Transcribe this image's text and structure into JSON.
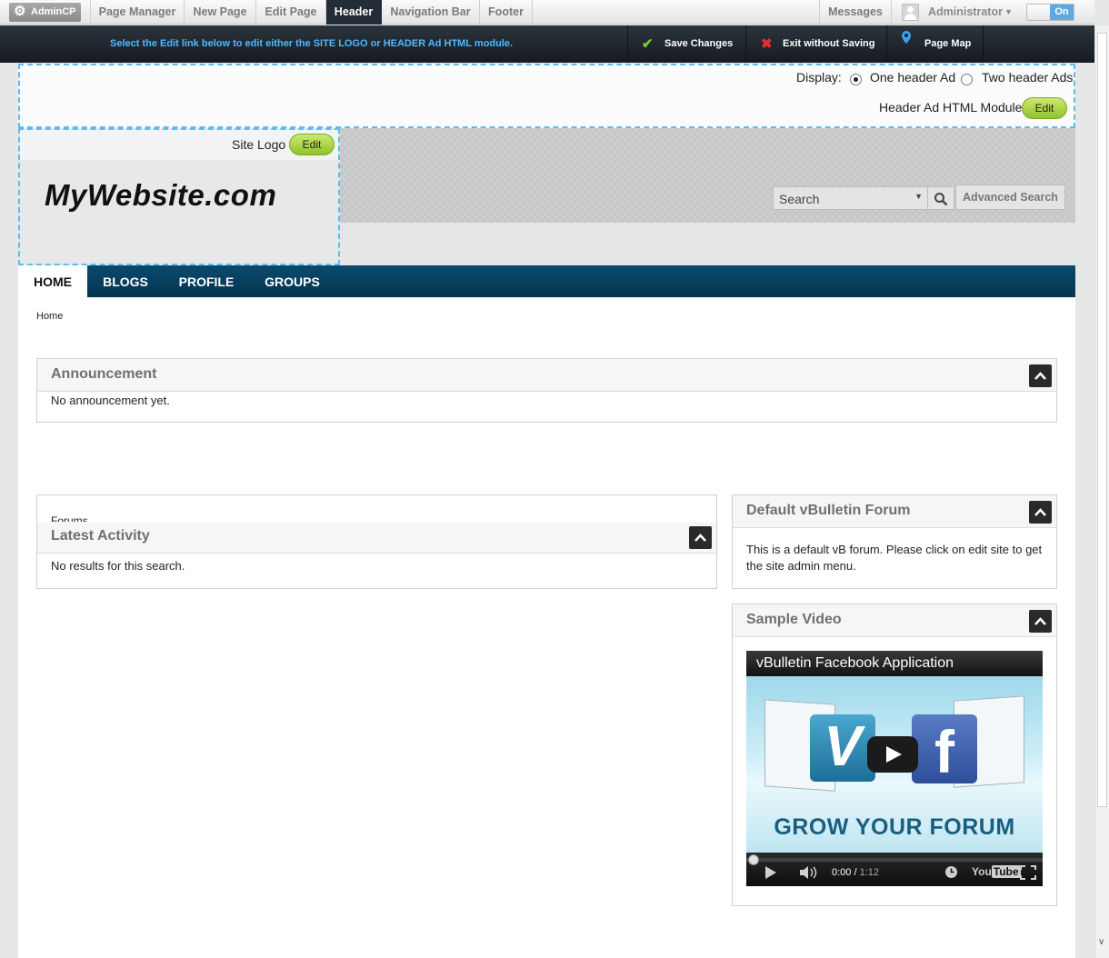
{
  "admin_toolbar": {
    "admincp_label": "AdminCP",
    "tabs": [
      {
        "label": "Page Manager",
        "active": false
      },
      {
        "label": "New Page",
        "active": false
      },
      {
        "label": "Edit Page",
        "active": false
      },
      {
        "label": "Header",
        "active": true
      },
      {
        "label": "Navigation Bar",
        "active": false
      },
      {
        "label": "Footer",
        "active": false
      }
    ],
    "messages_label": "Messages",
    "user_name": "Administrator",
    "toggle_label": "On"
  },
  "edit_bar": {
    "instruction": "Select the Edit link below to edit either the SITE LOGO or HEADER Ad HTML module.",
    "save_label": "Save Changes",
    "exit_label": "Exit without Saving",
    "page_map_label": "Page Map"
  },
  "header_ad": {
    "display_label": "Display:",
    "option_one": "One header Ad",
    "option_two": "Two header Ads",
    "selected": "One header Ad",
    "module_label": "Header Ad HTML Module",
    "edit_label": "Edit"
  },
  "site_logo": {
    "label": "Site Logo",
    "edit_label": "Edit",
    "site_title": "MyWebsite.com"
  },
  "search": {
    "placeholder": "Search",
    "advanced_label": "Advanced Search"
  },
  "nav": {
    "tabs": [
      {
        "label": "HOME",
        "active": true
      },
      {
        "label": "BLOGS",
        "active": false
      },
      {
        "label": "PROFILE",
        "active": false
      },
      {
        "label": "GROUPS",
        "active": false
      }
    ]
  },
  "breadcrumb": "Home",
  "widgets": {
    "announcement": {
      "title": "Announcement",
      "body": "No announcement yet."
    },
    "latest_activity": {
      "hidden_title": "Forums",
      "title": "Latest Activity",
      "body": "No results for this search."
    },
    "default_forum": {
      "title": "Default vBulletin Forum",
      "body": "This is a default vB forum. Please click on edit site to get the site admin menu."
    },
    "sample_video": {
      "title": "Sample Video",
      "video_title": "vBulletin Facebook Application",
      "overlay_text": "GROW YOUR FORUM",
      "time_current": "0:00",
      "time_duration": "1:12",
      "progress": 0,
      "yt_you": "You",
      "yt_tube": "Tube"
    }
  },
  "colors": {
    "toolbar_active": "#232d37",
    "edit_instruction": "#4fb8ff",
    "nav_bar": "#05344f",
    "edit_button": "#8ec32b",
    "dashed_border": "#5ebdf0"
  },
  "icons": {
    "admincp": "gear-icon",
    "save": "check-icon",
    "exit": "x-icon",
    "page_map": "map-pin-icon",
    "search": "search-icon",
    "collapse": "chevron-up-icon"
  }
}
